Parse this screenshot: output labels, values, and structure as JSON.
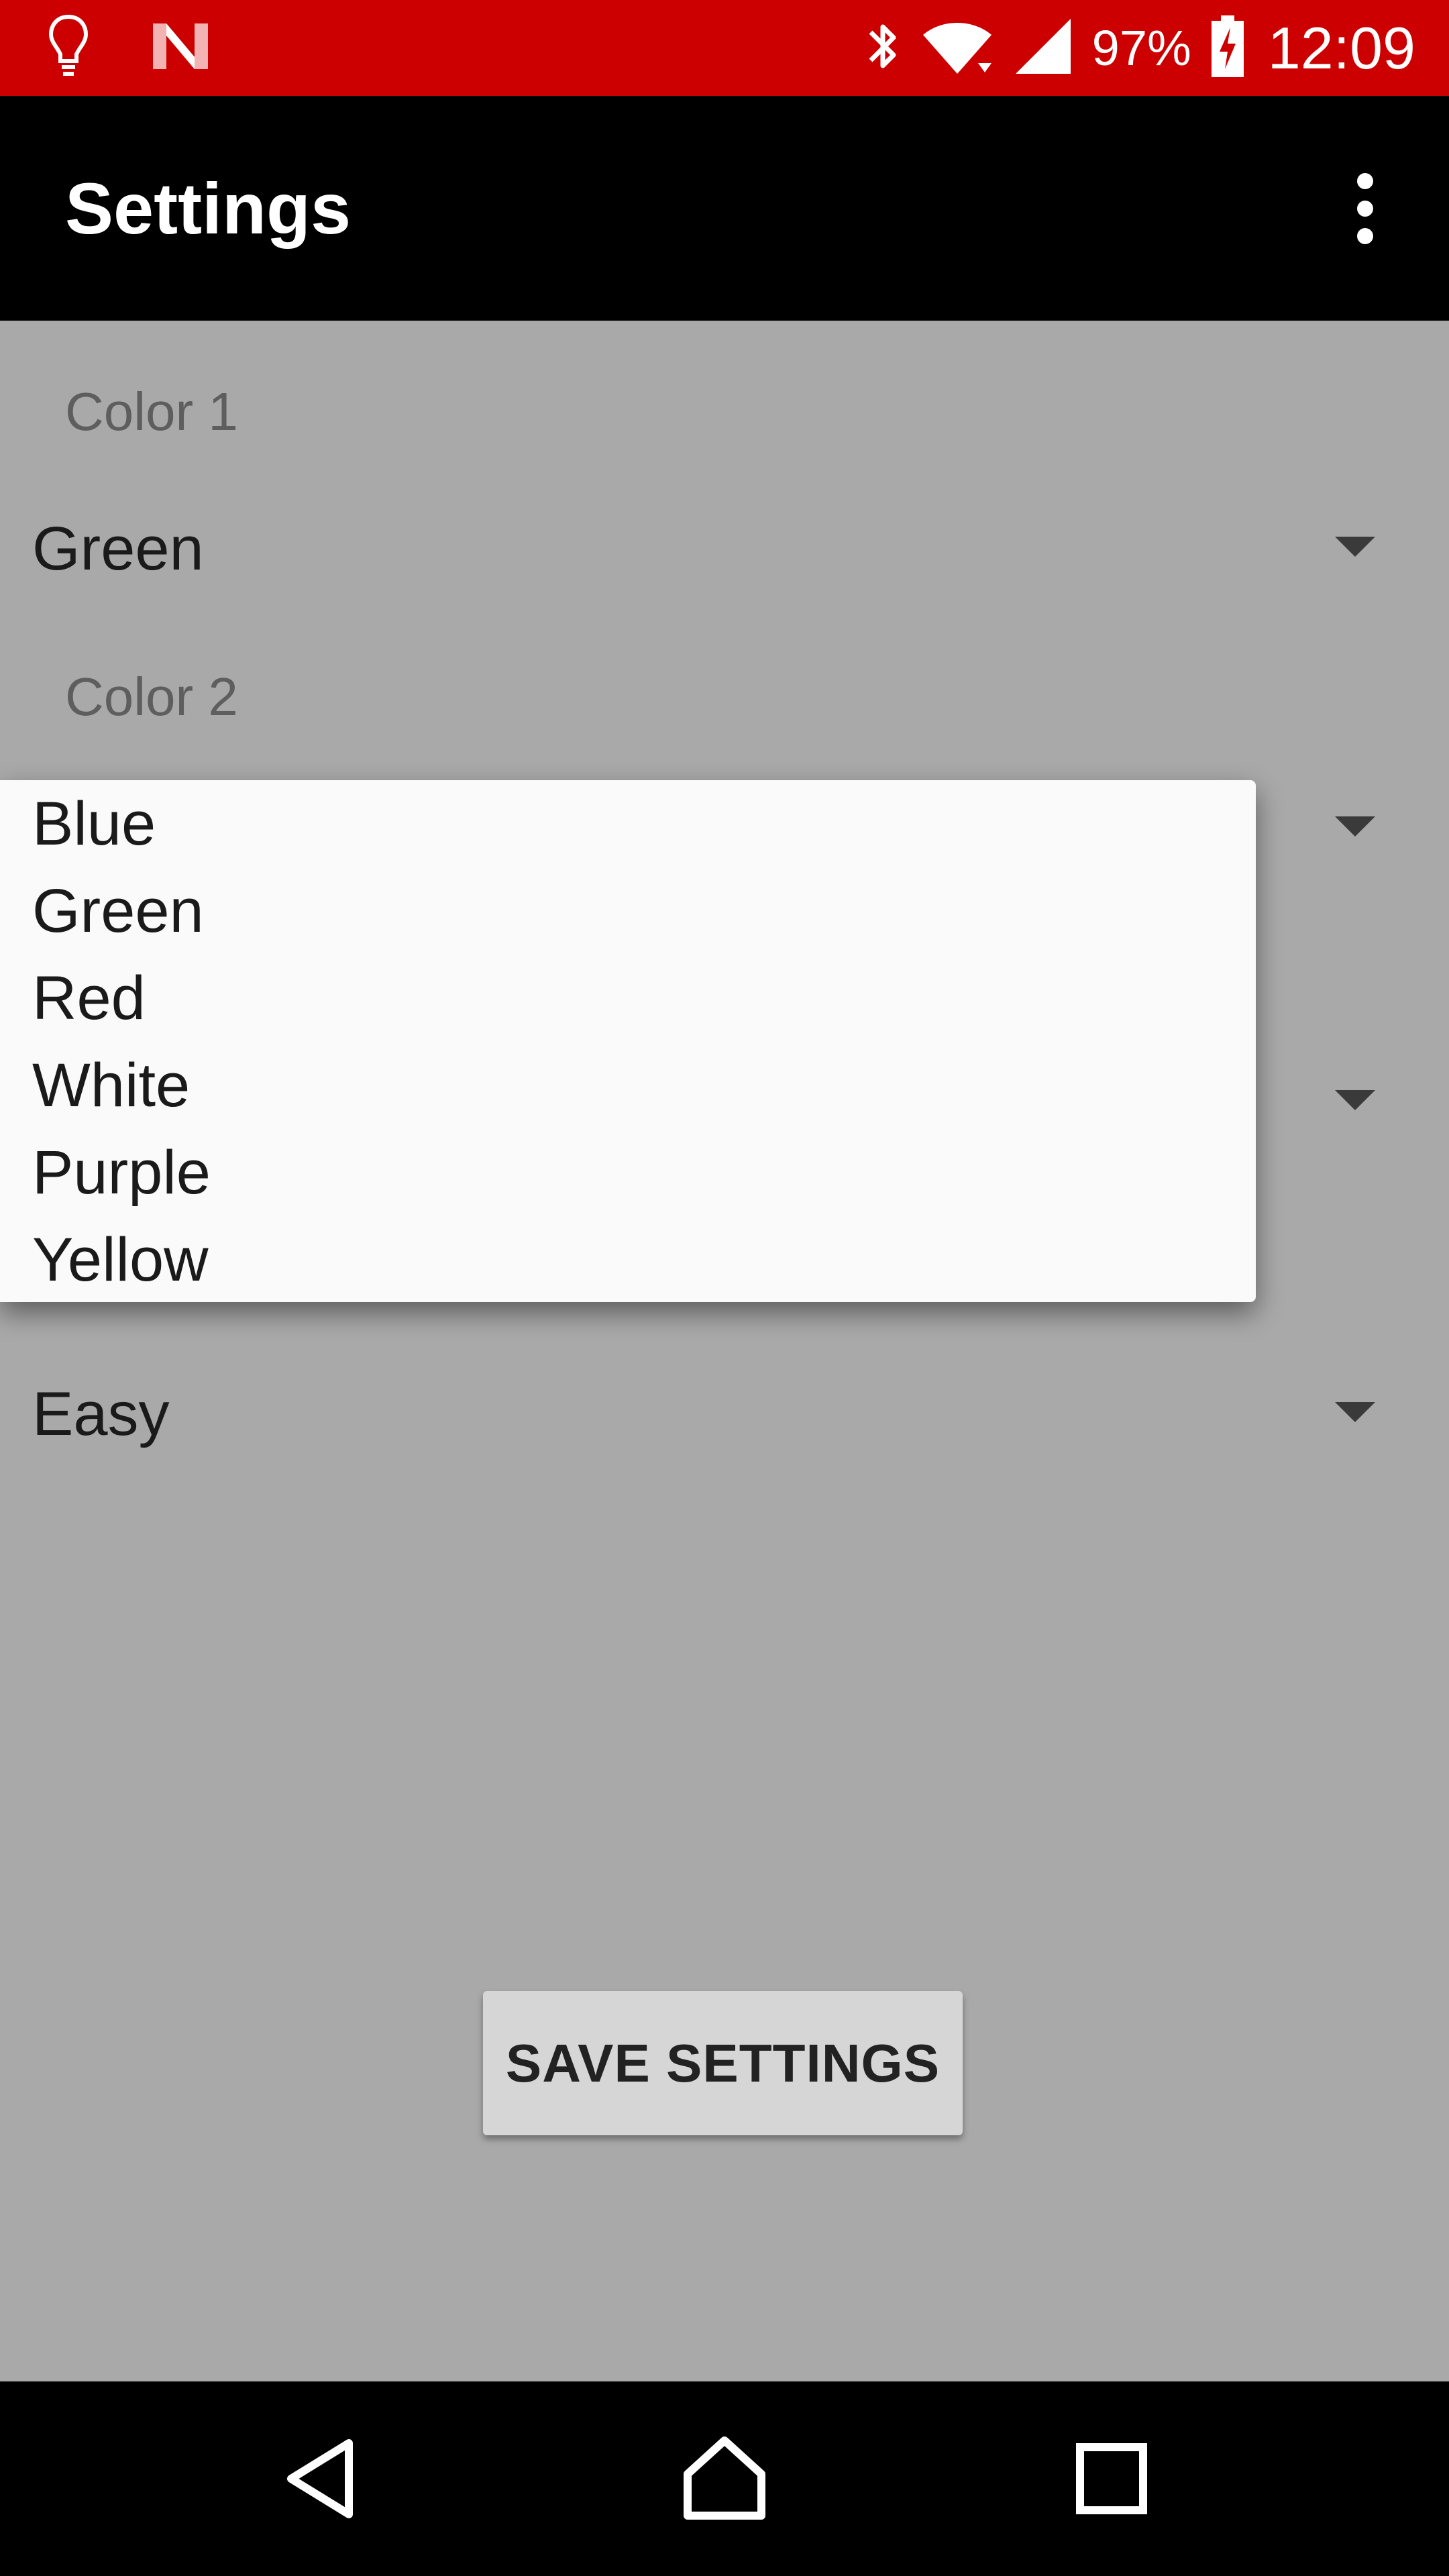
{
  "status_bar": {
    "battery_percent": "97%",
    "time": "12:09",
    "icons": [
      "lightbulb-icon",
      "news-icon",
      "bluetooth-icon",
      "wifi-icon",
      "cell-signal-icon",
      "battery-charging-icon"
    ]
  },
  "app_bar": {
    "title": "Settings",
    "overflow_icon": "more-vertical-icon"
  },
  "form": {
    "color1_label": "Color 1",
    "color1_value": "Green",
    "color2_label": "Color 2",
    "difficulty_value": "Easy"
  },
  "dropdown": {
    "options": [
      "Blue",
      "Green",
      "Red",
      "White",
      "Purple",
      "Yellow"
    ]
  },
  "save_button": {
    "label": "SAVE SETTINGS"
  },
  "nav_bar": {
    "icons": [
      "back-icon",
      "home-icon",
      "recents-icon"
    ]
  },
  "colors": {
    "status_bar": "#cc0000",
    "app_bar": "#000000",
    "scrim_background": "#a9a9a9",
    "popup_background": "#fafafa"
  }
}
